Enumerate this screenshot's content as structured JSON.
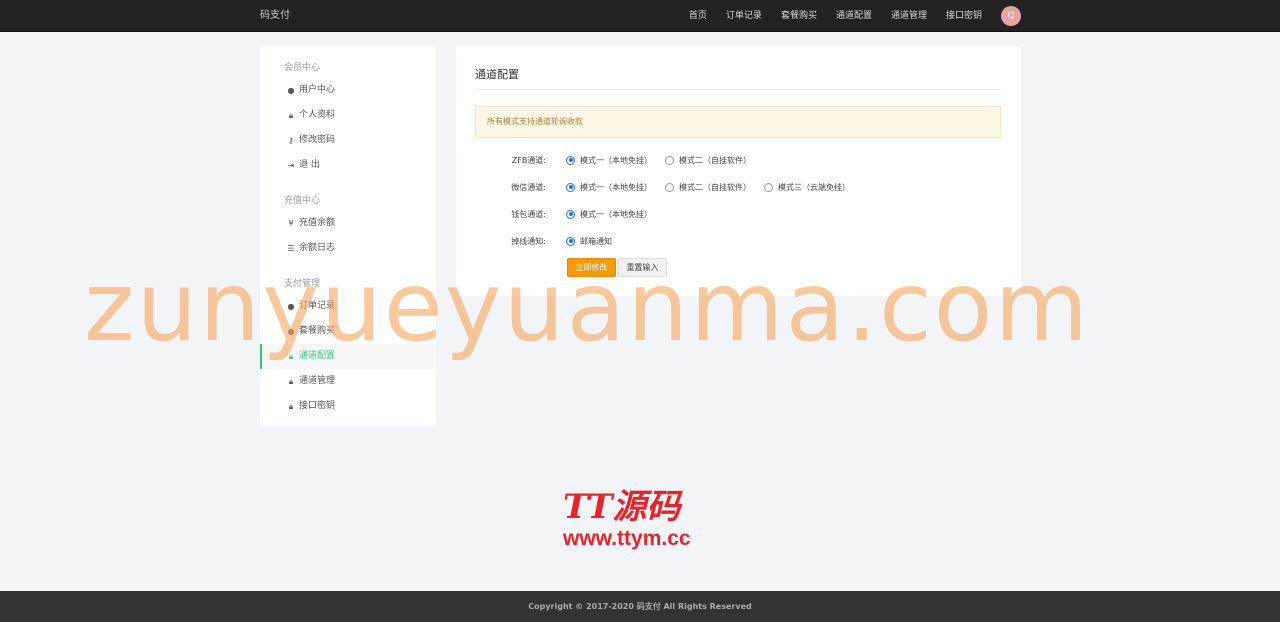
{
  "header": {
    "brand": "码支付",
    "nav": [
      "首页",
      "订单记录",
      "套餐购买",
      "通道配置",
      "通道管理",
      "接口密钥"
    ],
    "avatar_letter": "Q"
  },
  "sidebar": {
    "sections": [
      {
        "title": "会员中心",
        "items": [
          {
            "label": "用户中心",
            "icon": "user-circle-icon"
          },
          {
            "label": "个人资料",
            "icon": "lock-icon"
          },
          {
            "label": "修改密码",
            "icon": "key-icon"
          },
          {
            "label": "退 出",
            "icon": "logout-icon"
          }
        ]
      },
      {
        "title": "充值中心",
        "items": [
          {
            "label": "充值余额",
            "icon": "yen-icon"
          },
          {
            "label": "余额日志",
            "icon": "list-icon"
          }
        ]
      },
      {
        "title": "支付管理",
        "items": [
          {
            "label": "订单记录",
            "icon": "user-circle-icon"
          },
          {
            "label": "套餐购买",
            "icon": "user-circle-icon"
          },
          {
            "label": "通道配置",
            "icon": "lock-icon",
            "active": true
          },
          {
            "label": "通道管理",
            "icon": "lock-icon"
          },
          {
            "label": "接口密钥",
            "icon": "lock-icon"
          }
        ]
      }
    ]
  },
  "panel": {
    "title": "通道配置",
    "alert": "所有模式支持通道轮询收款",
    "rows": [
      {
        "label": "ZFB通道:",
        "options": [
          {
            "text": "模式一（本地免挂）",
            "checked": true
          },
          {
            "text": "模式二（自挂软件）",
            "checked": false
          }
        ]
      },
      {
        "label": "微信通道:",
        "options": [
          {
            "text": "模式一（本地免挂）",
            "checked": true
          },
          {
            "text": "模式二（自挂软件）",
            "checked": false
          },
          {
            "text": "模式三（云端免挂）",
            "checked": false
          }
        ]
      },
      {
        "label": "钱包通道:",
        "options": [
          {
            "text": "模式一（本地免挂）",
            "checked": true
          }
        ]
      },
      {
        "label": "掉线通知:",
        "options": [
          {
            "text": "邮箱通知",
            "checked": true
          }
        ]
      }
    ],
    "submit_label": "立即修改",
    "reset_label": "重置输入"
  },
  "watermark": "zunyueyuanma.com",
  "logo": {
    "title": "TT源码",
    "url": "www.ttym.cc"
  },
  "footer": "Copyright © 2017-2020 码支付 All Rights Reserved",
  "colors": {
    "accent": "#34c77b",
    "submit": "#f59a0a",
    "radio": "#1a73e8",
    "watermark": "#f6a762"
  }
}
